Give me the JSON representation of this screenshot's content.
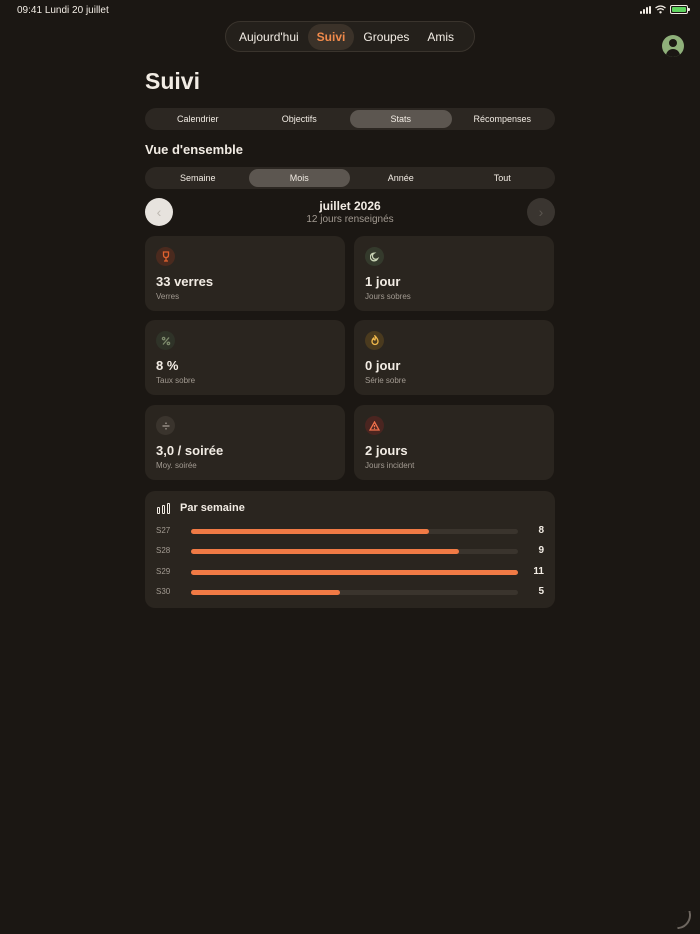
{
  "status": {
    "time": "09:41",
    "date": "Lundi 20 juillet"
  },
  "top_tabs": [
    "Aujourd'hui",
    "Suivi",
    "Groupes",
    "Amis"
  ],
  "top_tab_active": 1,
  "page_title": "Suivi",
  "view_tabs": [
    "Calendrier",
    "Objectifs",
    "Stats",
    "Récompenses"
  ],
  "view_tab_active": 2,
  "section_title": "Vue d'ensemble",
  "period_tabs": [
    "Semaine",
    "Mois",
    "Année",
    "Tout"
  ],
  "period_tab_active": 1,
  "month_nav": {
    "title": "juillet 2026",
    "subtitle": "12 jours renseignés"
  },
  "stats": [
    {
      "value": "33 verres",
      "label": "Verres",
      "icon": "wine-glass-icon",
      "icon_color": "#e0622f",
      "icon_bg": "#4a2a1e"
    },
    {
      "value": "1 jour",
      "label": "Jours sobres",
      "icon": "moon-icon",
      "icon_color": "#c9d4b5",
      "icon_bg": "#343a2c"
    },
    {
      "value": "8 %",
      "label": "Taux sobre",
      "icon": "percent-icon",
      "icon_color": "#7d8a6c",
      "icon_bg": "#2f3328"
    },
    {
      "value": "0 jour",
      "label": "Série sobre",
      "icon": "flame-icon",
      "icon_color": "#f0b84b",
      "icon_bg": "#4a3a1e"
    },
    {
      "value": "3,0 / soirée",
      "label": "Moy. soirée",
      "icon": "divide-icon",
      "icon_color": "#a39b92",
      "icon_bg": "#3a342d"
    },
    {
      "value": "2 jours",
      "label": "Jours incident",
      "icon": "warning-icon",
      "icon_color": "#f0704b",
      "icon_bg": "#4a2520"
    }
  ],
  "weekly": {
    "title": "Par semaine",
    "max": 11,
    "rows": [
      {
        "week": "S27",
        "count": 8
      },
      {
        "week": "S28",
        "count": 9
      },
      {
        "week": "S29",
        "count": 11
      },
      {
        "week": "S30",
        "count": 5
      }
    ]
  }
}
